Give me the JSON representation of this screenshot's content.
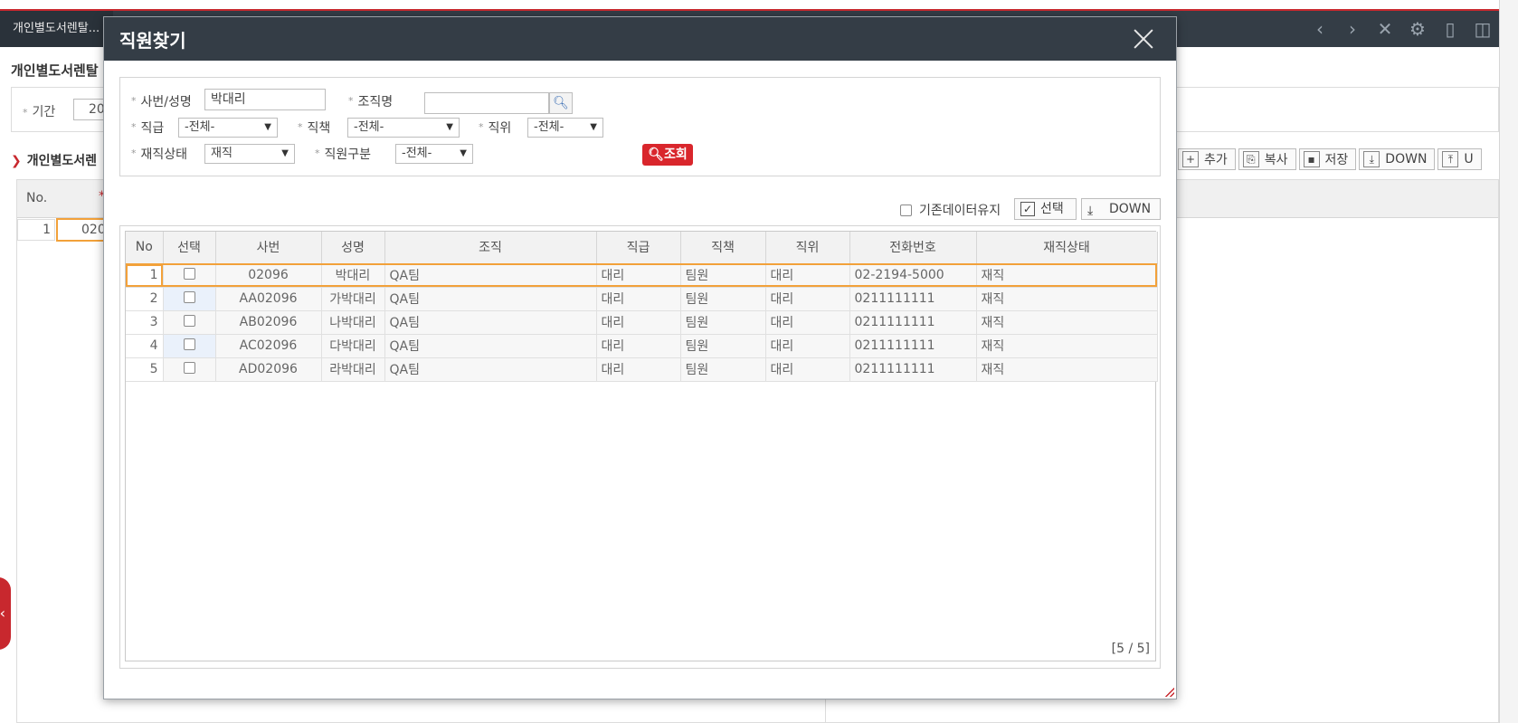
{
  "app": {
    "tab_label": "개인별도서렌탈...",
    "page_title": "개인별도서렌탈",
    "period_label": "기간",
    "period_value": "20",
    "section_title": "개인별도서렌",
    "toolbar": {
      "add_label": "추가",
      "copy_label": "복사",
      "save_label": "저장",
      "down_label": "DOWN",
      "up_label": "U"
    },
    "grid": {
      "col_no": "No.",
      "required_mark": "*",
      "row_no": "1",
      "row_value": "020"
    }
  },
  "modal": {
    "title": "직원찾기",
    "search": {
      "emp_label": "사번/성명",
      "emp_value": "박대리",
      "org_label": "조직명",
      "org_value": "",
      "grade_label": "직급",
      "grade_value": "-전체-",
      "duty_label": "직책",
      "duty_value": "-전체-",
      "position_label": "직위",
      "position_value": "-전체-",
      "status_label": "재직상태",
      "status_value": "재직",
      "type_label": "직원구분",
      "type_value": "-전체-",
      "query_label": "조회"
    },
    "keep_label": "기존데이터유지",
    "select_label": "선택",
    "down_label": "DOWN",
    "columns": [
      "No",
      "선택",
      "사번",
      "성명",
      "조직",
      "직급",
      "직책",
      "직위",
      "전화번호",
      "재직상태"
    ],
    "rows": [
      {
        "no": "1",
        "id": "02096",
        "name": "박대리",
        "org": "QA팀",
        "grade": "대리",
        "duty": "팀원",
        "position": "대리",
        "phone": "02-2194-5000",
        "status": "재직"
      },
      {
        "no": "2",
        "id": "AA02096",
        "name": "가박대리",
        "org": "QA팀",
        "grade": "대리",
        "duty": "팀원",
        "position": "대리",
        "phone": "0211111111",
        "status": "재직"
      },
      {
        "no": "3",
        "id": "AB02096",
        "name": "나박대리",
        "org": "QA팀",
        "grade": "대리",
        "duty": "팀원",
        "position": "대리",
        "phone": "0211111111",
        "status": "재직"
      },
      {
        "no": "4",
        "id": "AC02096",
        "name": "다박대리",
        "org": "QA팀",
        "grade": "대리",
        "duty": "팀원",
        "position": "대리",
        "phone": "0211111111",
        "status": "재직"
      },
      {
        "no": "5",
        "id": "AD02096",
        "name": "라박대리",
        "org": "QA팀",
        "grade": "대리",
        "duty": "팀원",
        "position": "대리",
        "phone": "0211111111",
        "status": "재직"
      }
    ],
    "count_label": "[5 / 5]"
  }
}
